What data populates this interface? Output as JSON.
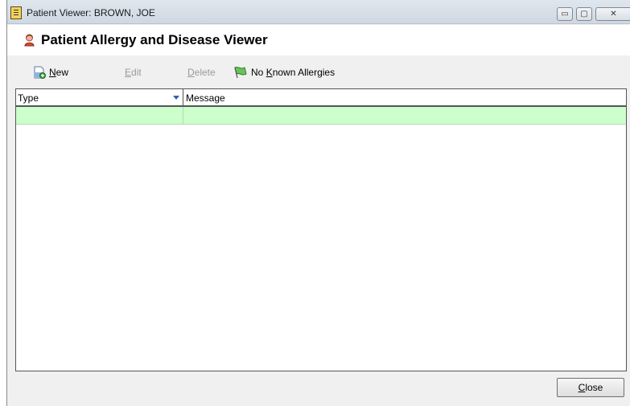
{
  "window": {
    "title": "Patient Viewer: BROWN, JOE",
    "controls": [
      "minimize-icon",
      "maximize-icon",
      "close-icon"
    ]
  },
  "header": {
    "title": "Patient Allergy and Disease Viewer",
    "icon": "patient-icon"
  },
  "toolbar": {
    "new_label_u": "N",
    "new_label_rest": "ew",
    "edit_label_u": "E",
    "edit_label_rest": "dit",
    "delete_label_u": "D",
    "delete_label_rest": "elete",
    "nka_label_pre": "No ",
    "nka_label_u": "K",
    "nka_label_rest": "nown Allergies"
  },
  "grid": {
    "columns": [
      "Type",
      "Message"
    ],
    "rows": [
      {
        "type": "",
        "message": ""
      }
    ]
  },
  "footer": {
    "close_label_u": "C",
    "close_label_rest": "lose"
  },
  "colors": {
    "row_highlight": "#ccffcc",
    "sort_arrow": "#2a63b8"
  }
}
